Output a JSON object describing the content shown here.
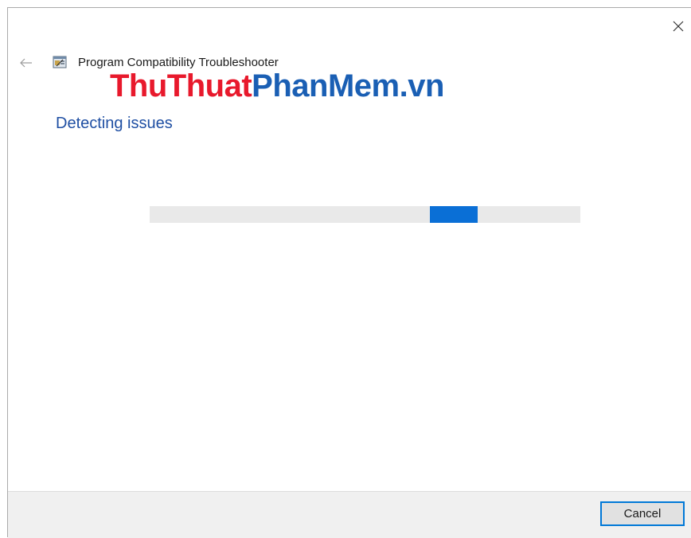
{
  "window": {
    "title": "Program Compatibility Troubleshooter",
    "close_icon": "close-icon",
    "back_icon": "back-arrow-icon",
    "app_icon": "troubleshooter-icon"
  },
  "watermark": {
    "part1": "ThuThuat",
    "part2": "PhanMem.vn",
    "color1": "#e8192c",
    "color2": "#1a5fb4"
  },
  "main": {
    "heading": "Detecting issues",
    "progress": {
      "indeterminate": true,
      "position_fraction": 0.66,
      "accent": "#0a6fd6"
    }
  },
  "footer": {
    "cancel_label": "Cancel"
  }
}
